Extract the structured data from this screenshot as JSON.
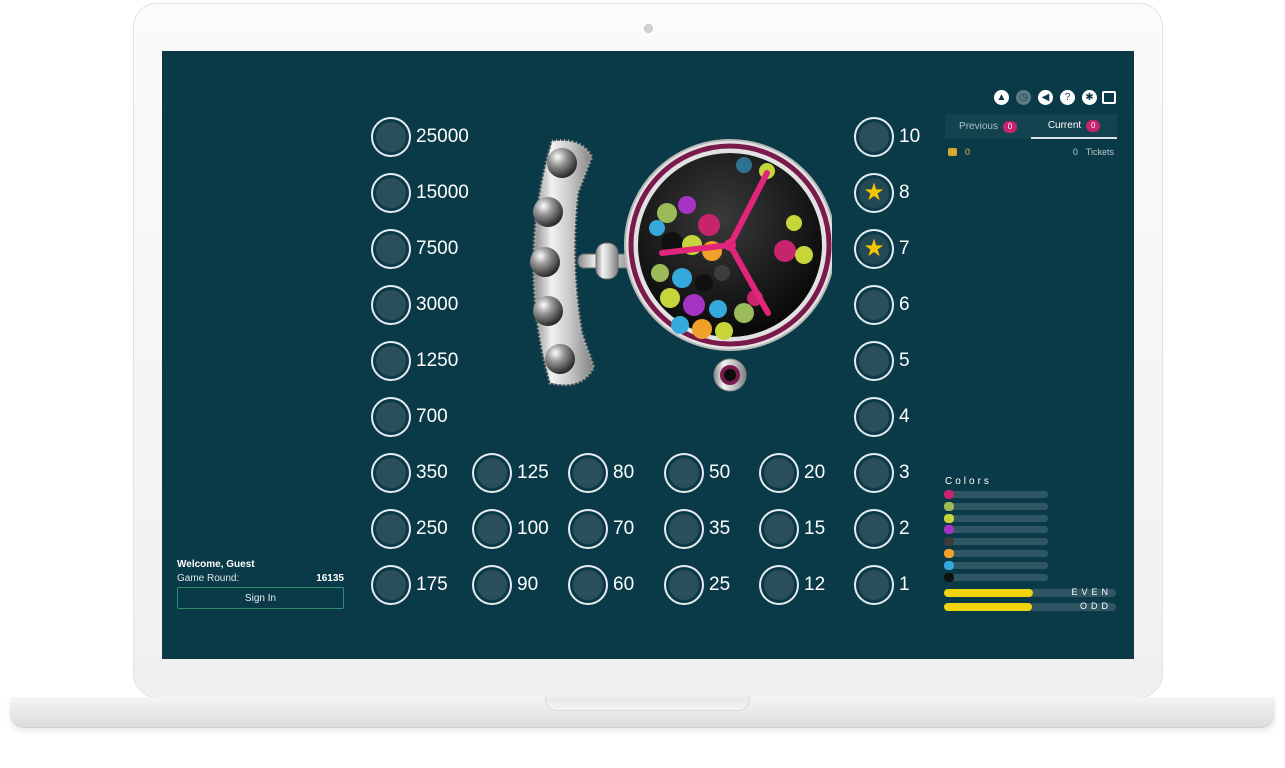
{
  "toolbar": {
    "icons": [
      "upload-icon",
      "history-icon",
      "sound-icon",
      "help-icon",
      "gear-icon",
      "fullscreen-icon"
    ]
  },
  "tabs": {
    "previous_label": "Previous",
    "previous_count": "0",
    "current_label": "Current",
    "current_count": "0"
  },
  "balance": {
    "coins": "0",
    "tickets_count": "0",
    "tickets_label": "Tickets"
  },
  "prizes": {
    "left_column": [
      "25000",
      "15000",
      "7500",
      "3000",
      "1250",
      "700",
      "350",
      "250",
      "175"
    ],
    "bottom_grid": [
      [
        "125",
        "80",
        "50",
        "20"
      ],
      [
        "100",
        "70",
        "35",
        "15"
      ],
      [
        "90",
        "60",
        "25",
        "12"
      ]
    ],
    "right_column": [
      "10",
      "8",
      "7",
      "6",
      "5",
      "4",
      "3",
      "2",
      "1"
    ],
    "starred_right_index": [
      1,
      2
    ]
  },
  "colors_panel": {
    "title": "Colors",
    "swatches": [
      "#c8246e",
      "#9bbb59",
      "#c6d63a",
      "#a633c6",
      "#3d3d3d",
      "#f0a12c",
      "#35a8dc",
      "#111111"
    ]
  },
  "even_odd": {
    "even_label": "EVEN",
    "even_fraction": 0.52,
    "odd_label": "ODD",
    "odd_fraction": 0.51
  },
  "user": {
    "welcome": "Welcome, Guest",
    "round_label": "Game Round:",
    "round_value": "16135",
    "signin_label": "Sign In"
  },
  "colors": {
    "background": "#0a3a48",
    "accent_pink": "#c8246e",
    "accent_yellow": "#f1d40d"
  }
}
